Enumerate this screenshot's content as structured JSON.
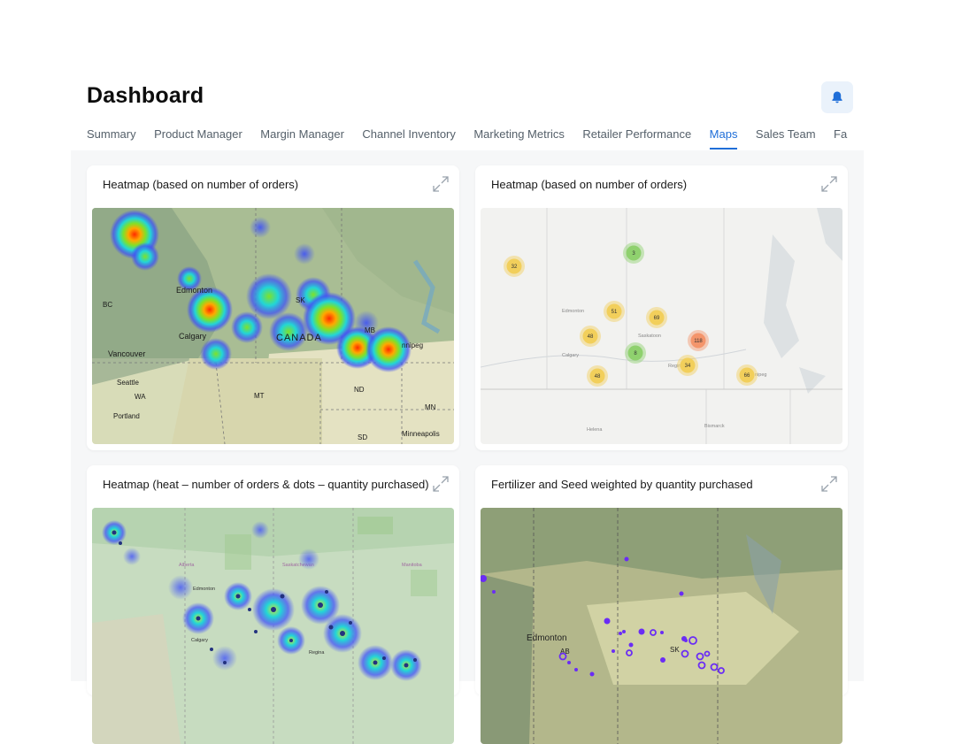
{
  "header": {
    "title": "Dashboard",
    "notification_icon": "bell-icon"
  },
  "tabs": [
    {
      "label": "Summary",
      "active": false
    },
    {
      "label": "Product Manager",
      "active": false
    },
    {
      "label": "Margin Manager",
      "active": false
    },
    {
      "label": "Channel Inventory",
      "active": false
    },
    {
      "label": "Marketing Metrics",
      "active": false
    },
    {
      "label": "Retailer Performance",
      "active": false
    },
    {
      "label": "Maps",
      "active": true
    },
    {
      "label": "Sales Team",
      "active": false
    },
    {
      "label": "Fa",
      "active": false
    }
  ],
  "colors": {
    "accent": "#1f6ed8",
    "cluster_yellow": "#f2cf5b",
    "cluster_green": "#8fd16e",
    "cluster_orange": "#f4956b",
    "dot_purple": "#6a2cf5"
  },
  "cards": [
    {
      "title": "Heatmap (based on number of orders)",
      "map_labels": [
        "Edmonton",
        "BC",
        "Calgary",
        "CANADA",
        "MB",
        "nnipeg",
        "Vancouver",
        "Seattle",
        "WA",
        "Portland",
        "MT",
        "ND",
        "MN",
        "SD",
        "Minneapolis",
        "SK"
      ]
    },
    {
      "title": "Heatmap (based on number of orders)",
      "clusters": [
        "32",
        "3",
        "51",
        "69",
        "48",
        "118",
        "8",
        "34",
        "48",
        "66"
      ],
      "map_labels": [
        "Edmonton",
        "Saskatoon",
        "Calgary",
        "Regina",
        "nipeg",
        "Helena",
        "Bismarck"
      ]
    },
    {
      "title": "Heatmap (heat – number of orders & dots – quantity purchased)",
      "map_labels": [
        "Alberta",
        "Saskatchewan",
        "Manitoba",
        "Edmonton",
        "Calgary",
        "Regina"
      ]
    },
    {
      "title": "Fertilizer and Seed weighted by quantity purchased",
      "map_labels": [
        "Edmonton",
        "AB",
        "SK"
      ]
    }
  ]
}
